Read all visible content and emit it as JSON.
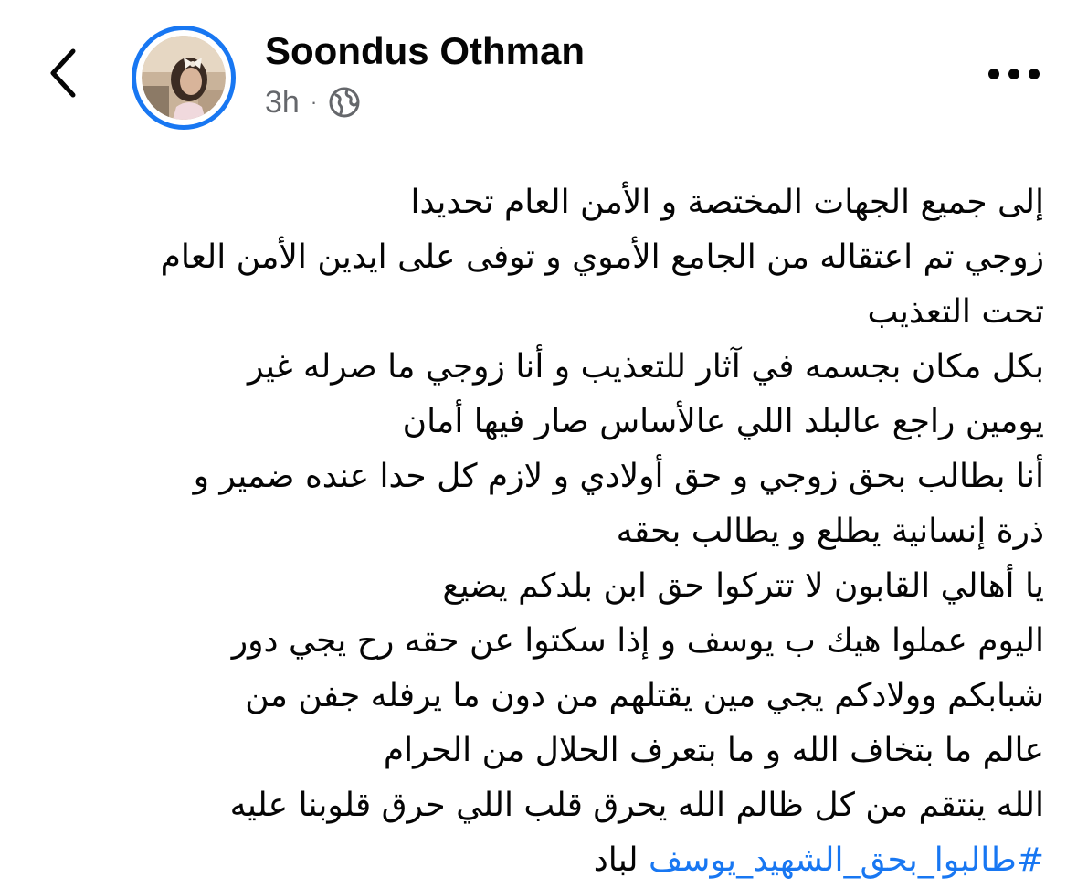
{
  "author": {
    "name": "Soondus Othman",
    "time": "3h",
    "separator": "·",
    "audience_icon": "globe-icon"
  },
  "header": {
    "back_icon": "chevron-left-icon",
    "more_icon": "more-horizontal-icon"
  },
  "post": {
    "lines": [
      "إلى جميع الجهات المختصة و الأمن العام تحديدا",
      "زوجي تم اعتقاله من الجامع الأموي و توفى على ايدين الأمن العام",
      "تحت التعذيب",
      "بكل  مكان بجسمه  في آثار للتعذيب و أنا زوجي ما صرله غير",
      "يومين راجع عالبلد اللي عالأساس صار فيها أمان",
      "أنا بطالب بحق زوجي و حق أولادي و لازم كل حدا عنده ضمير و",
      "ذرة إنسانية يطلع و يطالب بحقه",
      "يا أهالي القابون لا تتركوا حق ابن بلدكم يضيع",
      "اليوم عملوا هيك ب يوسف و إذا سكتوا عن حقه رح يجي دور",
      "شبابكم وولادكم يجي مين يقتلهم من دون ما يرفله جفن من",
      "عالم ما بتخاف الله و ما بتعرف الحلال من الحرام",
      "الله ينتقم من كل ظالم الله يحرق قلب اللي حرق قلوبنا عليه"
    ],
    "hashtag": "#طالبوا_بحق_الشهيد_يوسف",
    "after_hashtag": "لباد"
  },
  "colors": {
    "accent": "#1877f2",
    "text": "#050505",
    "secondary_text": "#65676b"
  }
}
